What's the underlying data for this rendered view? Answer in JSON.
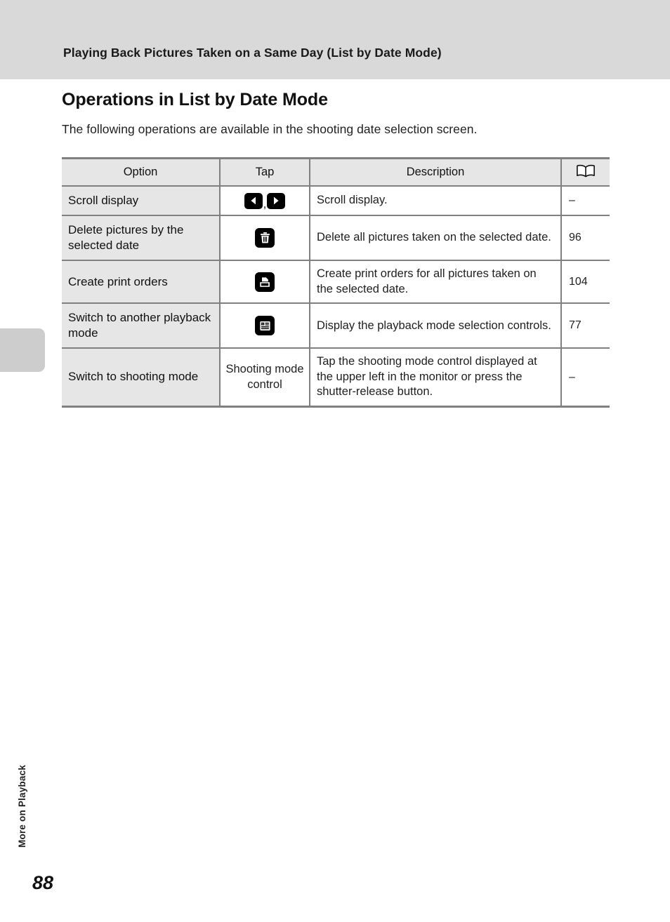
{
  "page": {
    "running_header": "Playing Back Pictures Taken on a Same Day (List by Date Mode)",
    "section_title": "Operations in List by Date Mode",
    "intro": "The following operations are available in the shooting date selection screen.",
    "page_number": "88",
    "side_tab_label": "More on Playback",
    "colors": {
      "header_band": "#d9d9d9",
      "table_shade": "#e6e6e6",
      "rule": "#808080",
      "side_tab": "#cdcdcd"
    }
  },
  "table": {
    "headers": {
      "option": "Option",
      "tap": "Tap",
      "description": "Description",
      "reference_icon": "open-book-icon"
    },
    "rows": [
      {
        "option": "Scroll display",
        "tap_kind": "icons",
        "tap_icons": [
          "left-arrow-icon",
          "right-arrow-icon"
        ],
        "tap_separator": ",",
        "tap_text": "",
        "description": "Scroll display.",
        "reference": "–"
      },
      {
        "option": "Delete pictures by the selected date",
        "tap_kind": "icon",
        "tap_icons": [
          "trash-icon"
        ],
        "tap_separator": "",
        "tap_text": "",
        "description": "Delete all pictures taken on the selected date.",
        "reference": "96"
      },
      {
        "option": "Create print orders",
        "tap_kind": "icon",
        "tap_icons": [
          "print-order-icon"
        ],
        "tap_separator": "",
        "tap_text": "",
        "description": "Create print orders for all pictures taken on the selected date.",
        "reference": "104"
      },
      {
        "option": "Switch to another playback mode",
        "tap_kind": "icon",
        "tap_icons": [
          "list-by-date-icon"
        ],
        "tap_separator": "",
        "tap_text": "",
        "description": "Display the playback mode selection controls.",
        "reference": "77"
      },
      {
        "option": "Switch to shooting mode",
        "tap_kind": "text",
        "tap_icons": [],
        "tap_separator": "",
        "tap_text": "Shooting mode control",
        "description": "Tap the shooting mode control displayed at the upper left in the monitor or press the shutter-release button.",
        "reference": "–"
      }
    ]
  }
}
